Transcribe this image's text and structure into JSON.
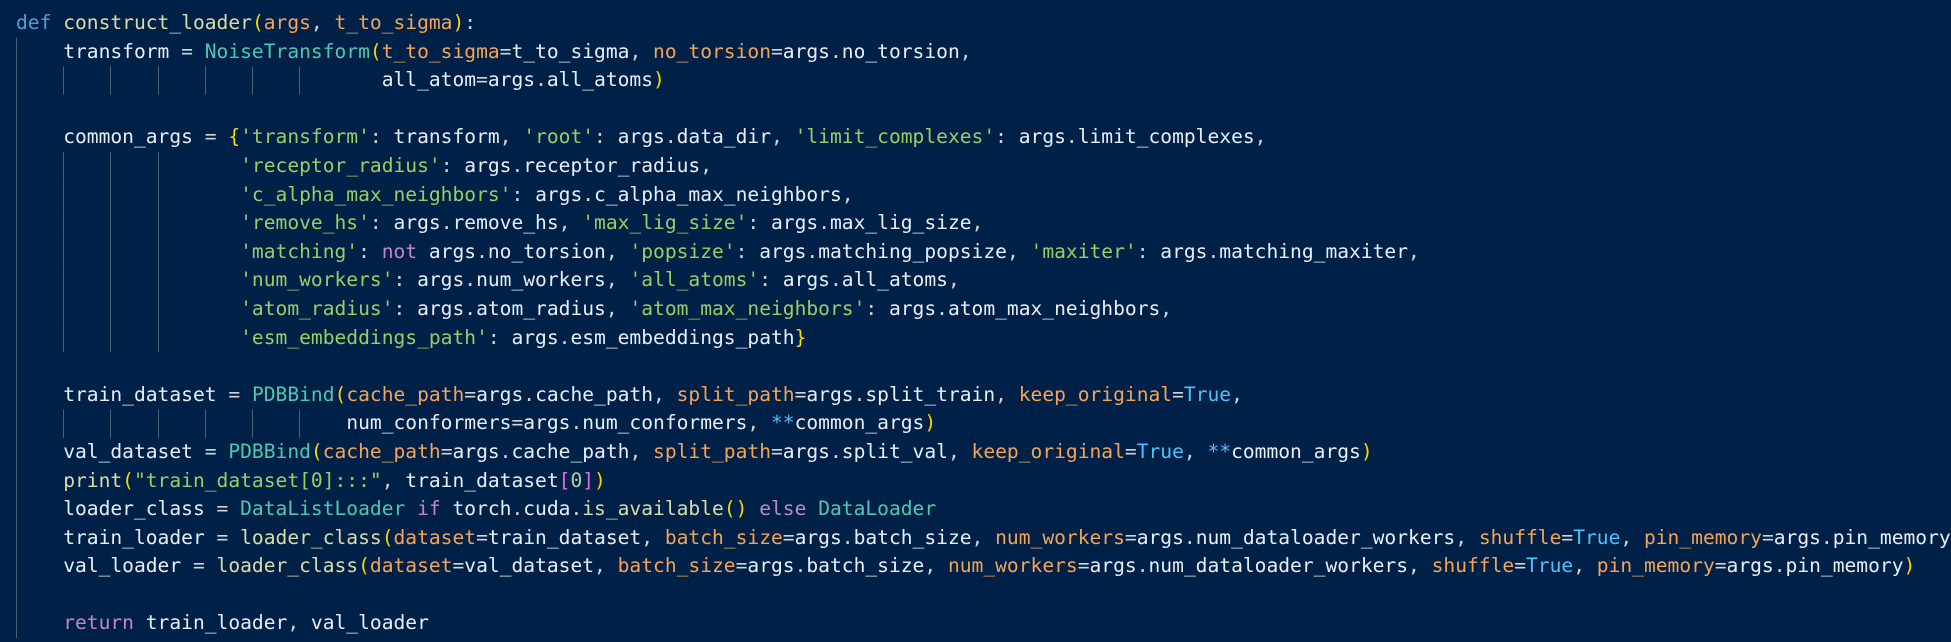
{
  "editor": {
    "language": "python",
    "theme_colors": {
      "background": "#002147",
      "keyword": "#c586c0",
      "def_keyword": "#569cd6",
      "function": "#dcdcaa",
      "class": "#4ec9b0",
      "parameter": "#f5a35a",
      "string": "#9ccc65",
      "builtin_const": "#4fc1ff",
      "bracket_level1": "#ffd700",
      "bracket_level2": "#da70d6",
      "indent_guide": "#4b5f7a"
    },
    "code_lines": [
      "def construct_loader(args, t_to_sigma):",
      "    transform = NoiseTransform(t_to_sigma=t_to_sigma, no_torsion=args.no_torsion,",
      "                               all_atom=args.all_atoms)",
      "",
      "    common_args = {'transform': transform, 'root': args.data_dir, 'limit_complexes': args.limit_complexes,",
      "                   'receptor_radius': args.receptor_radius,",
      "                   'c_alpha_max_neighbors': args.c_alpha_max_neighbors,",
      "                   'remove_hs': args.remove_hs, 'max_lig_size': args.max_lig_size,",
      "                   'matching': not args.no_torsion, 'popsize': args.matching_popsize, 'maxiter': args.matching_maxiter,",
      "                   'num_workers': args.num_workers, 'all_atoms': args.all_atoms,",
      "                   'atom_radius': args.atom_radius, 'atom_max_neighbors': args.atom_max_neighbors,",
      "                   'esm_embeddings_path': args.esm_embeddings_path}",
      "",
      "    train_dataset = PDBBind(cache_path=args.cache_path, split_path=args.split_train, keep_original=True,",
      "                            num_conformers=args.num_conformers, **common_args)",
      "    val_dataset = PDBBind(cache_path=args.cache_path, split_path=args.split_val, keep_original=True, **common_args)",
      "    print(\"train_dataset[0]:::\", train_dataset[0])",
      "    loader_class = DataListLoader if torch.cuda.is_available() else DataLoader",
      "    train_loader = loader_class(dataset=train_dataset, batch_size=args.batch_size, num_workers=args.num_dataloader_workers, shuffle=True, pin_memory=args.pin_memory)",
      "    val_loader = loader_class(dataset=val_dataset, batch_size=args.batch_size, num_workers=args.num_dataloader_workers, shuffle=True, pin_memory=args.pin_memory)",
      "",
      "    return train_loader, val_loader"
    ]
  }
}
